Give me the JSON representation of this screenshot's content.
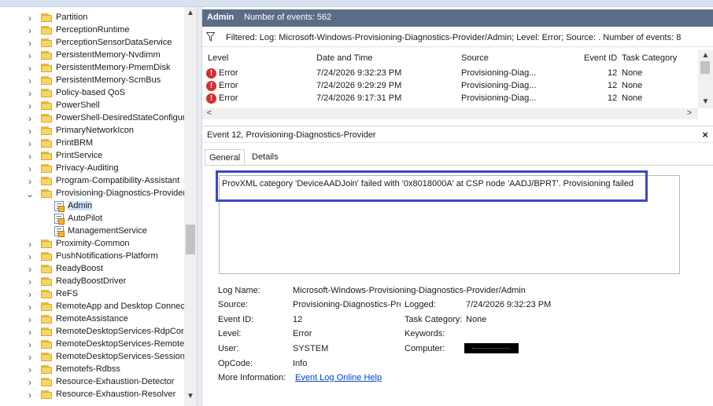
{
  "tree": {
    "items": [
      {
        "label": "Partition",
        "kind": "folder"
      },
      {
        "label": "PerceptionRuntime",
        "kind": "folder"
      },
      {
        "label": "PerceptionSensorDataService",
        "kind": "folder"
      },
      {
        "label": "PersistentMemory-Nvdimm",
        "kind": "folder"
      },
      {
        "label": "PersistentMemory-PmemDisk",
        "kind": "folder"
      },
      {
        "label": "PersistentMemory-ScmBus",
        "kind": "folder"
      },
      {
        "label": "Policy-based QoS",
        "kind": "folder"
      },
      {
        "label": "PowerShell",
        "kind": "folder"
      },
      {
        "label": "PowerShell-DesiredStateConfiguratic",
        "kind": "folder"
      },
      {
        "label": "PrimaryNetworkIcon",
        "kind": "folder"
      },
      {
        "label": "PrintBRM",
        "kind": "folder"
      },
      {
        "label": "PrintService",
        "kind": "folder"
      },
      {
        "label": "Privacy-Auditing",
        "kind": "folder"
      },
      {
        "label": "Program-Compatibility-Assistant",
        "kind": "folder"
      },
      {
        "label": "Provisioning-Diagnostics-Provider",
        "kind": "folder",
        "expanded": true
      },
      {
        "label": "Admin",
        "kind": "log",
        "selected": true
      },
      {
        "label": "AutoPilot",
        "kind": "log"
      },
      {
        "label": "ManagementService",
        "kind": "log"
      },
      {
        "label": "Proximity-Common",
        "kind": "folder"
      },
      {
        "label": "PushNotifications-Platform",
        "kind": "folder"
      },
      {
        "label": "ReadyBoost",
        "kind": "folder"
      },
      {
        "label": "ReadyBoostDriver",
        "kind": "folder"
      },
      {
        "label": "ReFS",
        "kind": "folder"
      },
      {
        "label": "RemoteApp and Desktop Connectio",
        "kind": "folder"
      },
      {
        "label": "RemoteAssistance",
        "kind": "folder"
      },
      {
        "label": "RemoteDesktopServices-RdpCoreTS",
        "kind": "folder"
      },
      {
        "label": "RemoteDesktopServices-RemoteFX-",
        "kind": "folder"
      },
      {
        "label": "RemoteDesktopServices-SessionSer",
        "kind": "folder"
      },
      {
        "label": "Remotefs-Rdbss",
        "kind": "folder"
      },
      {
        "label": "Resource-Exhaustion-Detector",
        "kind": "folder"
      },
      {
        "label": "Resource-Exhaustion-Resolver",
        "kind": "folder"
      }
    ]
  },
  "header": {
    "log_name": "Admin",
    "event_count": "Number of events: 562"
  },
  "filter": {
    "text": "Filtered: Log: Microsoft-Windows-Provisioning-Diagnostics-Provider/Admin; Level: Error; Source: . Number of events: 8"
  },
  "grid": {
    "columns": [
      "Level",
      "Date and Time",
      "Source",
      "Event ID",
      "Task Category"
    ],
    "rows": [
      {
        "level": "Error",
        "datetime": "7/24/2026 9:32:23 PM",
        "source": "Provisioning-Diag...",
        "event_id": "12",
        "category": "None"
      },
      {
        "level": "Error",
        "datetime": "7/24/2026 9:29:29 PM",
        "source": "Provisioning-Diag...",
        "event_id": "12",
        "category": "None"
      },
      {
        "level": "Error",
        "datetime": "7/24/2026 9:17:31 PM",
        "source": "Provisioning-Diag...",
        "event_id": "12",
        "category": "None"
      }
    ]
  },
  "event": {
    "title": "Event 12, Provisioning-Diagnostics-Provider",
    "close_glyph": "×",
    "tabs": [
      "General",
      "Details"
    ],
    "message": "ProvXML category 'DeviceAADJoin' failed with '0x8018000A' at CSP node 'AADJ/BPRT'. Provisioning failed",
    "fields": {
      "log_name_label": "Log Name:",
      "log_name": "Microsoft-Windows-Provisioning-Diagnostics-Provider/Admin",
      "source_label": "Source:",
      "source": "Provisioning-Diagnostics-Prov",
      "logged_label": "Logged:",
      "logged": "7/24/2026 9:32:23 PM",
      "event_id_label": "Event ID:",
      "event_id": "12",
      "task_category_label": "Task Category:",
      "task_category": "None",
      "level_label": "Level:",
      "level": "Error",
      "keywords_label": "Keywords:",
      "keywords": "",
      "user_label": "User:",
      "user": "SYSTEM",
      "computer_label": "Computer:",
      "opcode_label": "OpCode:",
      "opcode": "Info",
      "more_info_label": "More Information:",
      "more_info_link": "Event Log Online Help"
    }
  },
  "colors": {
    "title_bar": "#5b6d86",
    "highlight_box": "#3a49c4",
    "error_icon": "#d32f2f",
    "link": "#0044cc"
  },
  "icons": {
    "tree_chevron_collapsed": "›",
    "tree_chevron_expanded": "⌄",
    "scroll_up": "▲",
    "scroll_down": "▼",
    "scroll_left": "<",
    "scroll_right": ">",
    "error_glyph": "!"
  }
}
